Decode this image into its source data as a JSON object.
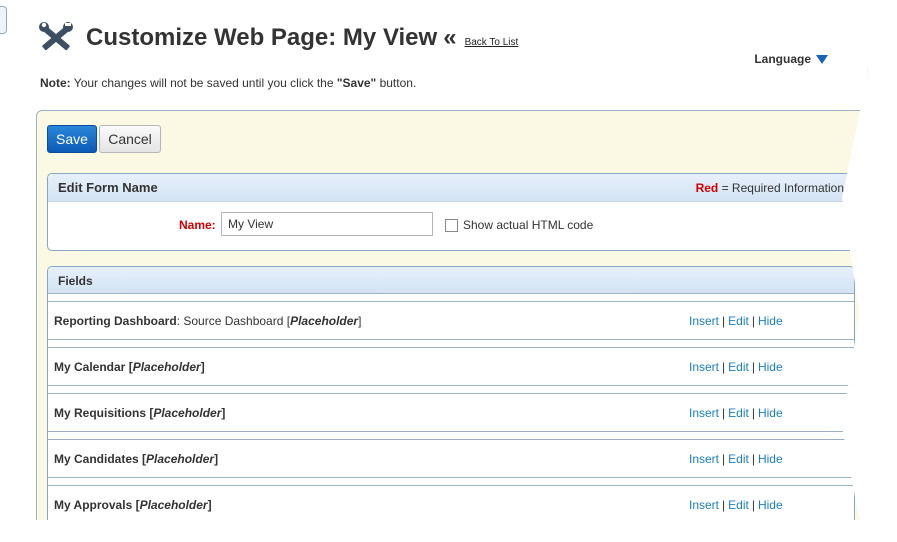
{
  "header": {
    "title": "Customize Web Page: My View",
    "raquo": "«",
    "back_link": "Back To List",
    "language": "Language"
  },
  "note": {
    "label": "Note:",
    "text_before": " Your changes will not be saved until you click the ",
    "save_word": "\"Save\"",
    "text_after": " button."
  },
  "toolbar": {
    "save_label": "Save",
    "cancel_label": "Cancel"
  },
  "form": {
    "title": "Edit Form Name",
    "required_red": "Red",
    "required_text": " = Required Information",
    "name_label": "Name:",
    "name_value": "My View",
    "checkbox_label": "Show actual HTML code"
  },
  "fields": {
    "title": "Fields",
    "rows": [
      {
        "name": "Reporting Dashboard",
        "detail": ": Source Dashboard ",
        "placeholder": "Placeholder"
      },
      {
        "name": "My Calendar ",
        "detail": "",
        "placeholder": "Placeholder"
      },
      {
        "name": "My Requisitions ",
        "detail": "",
        "placeholder": "Placeholder"
      },
      {
        "name": "My Candidates ",
        "detail": "",
        "placeholder": "Placeholder"
      },
      {
        "name": "My Approvals ",
        "detail": "",
        "placeholder": "Placeholder"
      }
    ],
    "actions": {
      "insert": "Insert",
      "edit": "Edit",
      "hide": "Hide",
      "sep": "|"
    }
  },
  "colors": {
    "accent_blue": "#1c63b7",
    "link_blue": "#1a7fc1",
    "required_red": "#cc0000",
    "panel_bg": "#fbf9e3"
  }
}
